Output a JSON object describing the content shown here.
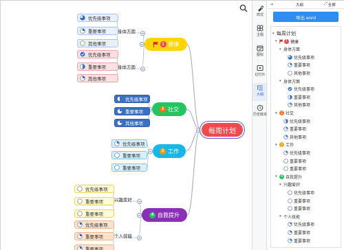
{
  "canvas": {
    "root": "每周计划",
    "branches": [
      {
        "label": "健康",
        "num": "1",
        "flag": true,
        "bg": "#ffd400",
        "text": "#ffffff",
        "badge": "#ef4444",
        "groups": [
          {
            "label": "身体方面",
            "items": [
              {
                "label": "优先级事项",
                "icon": "pie-75"
              },
              {
                "label": "重要事项",
                "icon": "pie-25"
              },
              {
                "label": "其他事项",
                "icon": "empty"
              }
            ],
            "leaf_bg": "#e7f0fb",
            "leaf_border": "#a8c4ea"
          },
          {
            "label": "身体方面",
            "items": [
              {
                "label": "优先级事项",
                "icon": "check"
              },
              {
                "label": "重要事项",
                "icon": "pie-50"
              },
              {
                "label": "其他事项",
                "icon": "pie-25"
              }
            ],
            "leaf_bg": "#fbe1e1",
            "leaf_border": "#e8a4a4"
          }
        ]
      },
      {
        "label": "社交",
        "num": "2",
        "flag": false,
        "bg": "#22c55e",
        "text": "#ffffff",
        "badge": "#f97316",
        "groups": [
          {
            "label": "",
            "items": [
              {
                "label": "优先级事项",
                "icon": "pie-50"
              },
              {
                "label": "重要事项",
                "icon": "pie-25"
              },
              {
                "label": "其他事项",
                "icon": "pie-25"
              }
            ],
            "leaf_bg": "#3a6fc4",
            "leaf_border": "#2f5da8",
            "leaf_text": "#ffffff"
          }
        ]
      },
      {
        "label": "工作",
        "num": "3",
        "flag": false,
        "bg": "#19b6e8",
        "text": "#ffffff",
        "badge": "#f59e0b",
        "groups": [
          {
            "label": "",
            "items": [
              {
                "label": "优先级事项",
                "icon": "pie-25"
              },
              {
                "label": "重要事项",
                "icon": "empty"
              },
              {
                "label": "重要事项",
                "icon": "empty"
              }
            ],
            "leaf_bg": "#d9f0fb",
            "leaf_border": "#7cc8ea"
          }
        ]
      },
      {
        "label": "自我提升",
        "num": "4",
        "flag": false,
        "bg": "#8b2fb8",
        "text": "#ffffff",
        "badge": "#22c55e",
        "groups": [
          {
            "label": "兴趣爱好",
            "items": [
              {
                "label": "优先级事项",
                "icon": "empty"
              },
              {
                "label": "重要事项",
                "icon": "empty"
              },
              {
                "label": "重要事项",
                "icon": "empty"
              }
            ],
            "leaf_bg": "#fffbd6",
            "leaf_border": "#e8d84a"
          },
          {
            "label": "个人技能",
            "items": [
              {
                "label": "优先级事项",
                "icon": "pie-25"
              },
              {
                "label": "重要事项",
                "icon": "pie-25"
              },
              {
                "label": "重要事项",
                "icon": "pie-25"
              }
            ],
            "leaf_bg": "#fde3cf",
            "leaf_border": "#eeb48a"
          }
        ]
      }
    ]
  },
  "tools": [
    {
      "label": "样式",
      "icon": "brush-icon"
    },
    {
      "label": "主题",
      "icon": "theme-icon"
    },
    {
      "label": "图标",
      "icon": "calendar-icon"
    },
    {
      "label": "幻灯片",
      "icon": "slides-icon"
    },
    {
      "label": "大纲",
      "icon": "outline-icon",
      "active": true
    },
    {
      "label": "历史版本",
      "icon": "history-icon"
    }
  ],
  "panel": {
    "title": "大纲",
    "fullscreen": "全屏",
    "export": "导出 word",
    "outline": [
      {
        "label": "每周计划",
        "level": 0,
        "icon": "none",
        "tri": "▾"
      },
      {
        "label": "健康",
        "level": 1,
        "icon": "num",
        "num": "1",
        "color": "#ef4444",
        "flag": true,
        "tri": "▾"
      },
      {
        "label": "身体方面",
        "level": 2,
        "icon": "none",
        "tri": "▾"
      },
      {
        "label": "优先级事项",
        "level": 3,
        "icon": "pie-75"
      },
      {
        "label": "重要事项",
        "level": 3,
        "icon": "pie-25"
      },
      {
        "label": "其他事项",
        "level": 3,
        "icon": "empty"
      },
      {
        "label": "身体方面",
        "level": 2,
        "icon": "none",
        "tri": "▾"
      },
      {
        "label": "优先级事项",
        "level": 3,
        "icon": "check"
      },
      {
        "label": "重要事项",
        "level": 3,
        "icon": "pie-50"
      },
      {
        "label": "其他事项",
        "level": 3,
        "icon": "pie-25"
      },
      {
        "label": "社交",
        "level": 1,
        "icon": "num",
        "num": "2",
        "color": "#f97316",
        "tri": "▾"
      },
      {
        "label": "优先级事项",
        "level": 2,
        "icon": "pie-50"
      },
      {
        "label": "重要事项",
        "level": 2,
        "icon": "pie-25"
      },
      {
        "label": "其他事项",
        "level": 2,
        "icon": "pie-25"
      },
      {
        "label": "工作",
        "level": 1,
        "icon": "num",
        "num": "3",
        "color": "#f59e0b",
        "tri": "▾"
      },
      {
        "label": "优先级事项",
        "level": 2,
        "icon": "pie-25"
      },
      {
        "label": "重要事项",
        "level": 2,
        "icon": "empty"
      },
      {
        "label": "重要事项",
        "level": 2,
        "icon": "empty"
      },
      {
        "label": "自我提升",
        "level": 1,
        "icon": "num",
        "num": "4",
        "color": "#22c55e",
        "tri": "▾"
      },
      {
        "label": "兴趣爱好",
        "level": 2,
        "icon": "none",
        "tri": "▾"
      },
      {
        "label": "优先级事项",
        "level": 3,
        "icon": "empty"
      },
      {
        "label": "重要事项",
        "level": 3,
        "icon": "empty"
      },
      {
        "label": "重要事项",
        "level": 3,
        "icon": "empty"
      },
      {
        "label": "个人技能",
        "level": 2,
        "icon": "none",
        "tri": "▾"
      },
      {
        "label": "优先级事项",
        "level": 3,
        "icon": "pie-25"
      },
      {
        "label": "重要事项",
        "level": 3,
        "icon": "pie-25"
      },
      {
        "label": "重要事项",
        "level": 3,
        "icon": "pie-25"
      }
    ]
  }
}
